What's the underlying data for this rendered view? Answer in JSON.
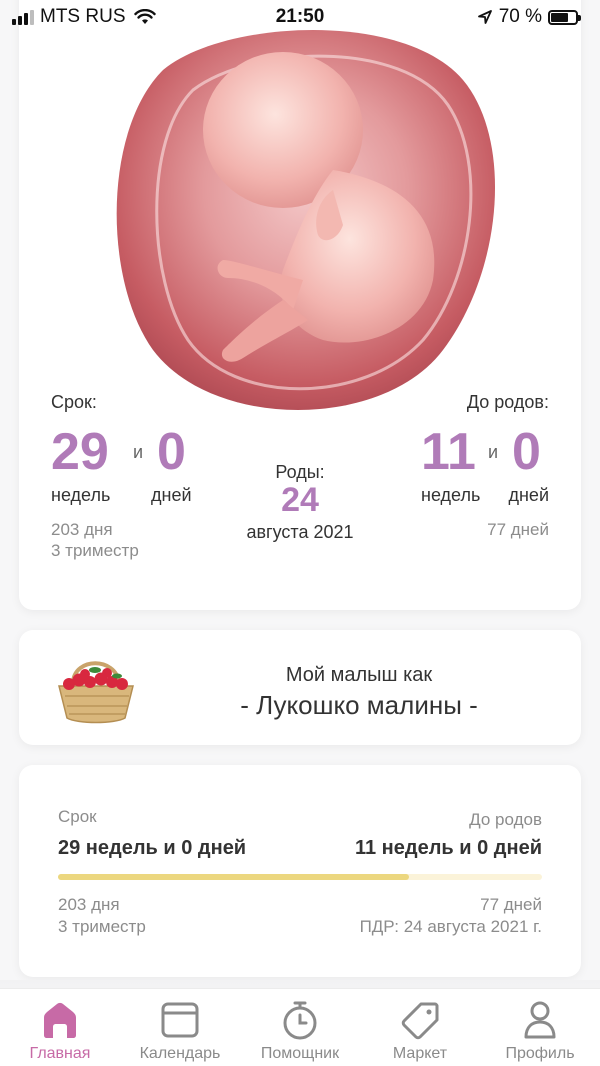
{
  "status_bar": {
    "carrier": "MTS RUS",
    "time": "21:50",
    "battery": "70 %",
    "battery_level": 0.7
  },
  "summary": {
    "term_label": "Срок:",
    "term_weeks": "29",
    "and": "и",
    "term_days": "0",
    "weeks_label": "недель",
    "days_label": "дней",
    "term_total_days": "203 дня",
    "trimester": "3 триместр",
    "birth_label": "Роды:",
    "birth_day": "24",
    "birth_month_year": "августа 2021",
    "until_label": "До родов:",
    "until_weeks": "11",
    "until_days": "0",
    "until_total_days": "77 дней"
  },
  "fruit": {
    "intro": "Мой малыш как",
    "name": "- Лукошко малины -"
  },
  "progress": {
    "term_label": "Срок",
    "term_value": "29 недель и 0 дней",
    "until_label": "До родов",
    "until_value": "11 недель и 0 дней",
    "fraction": 0.725,
    "left_days": "203 дня",
    "left_trimester": "3 триместр",
    "right_days": "77 дней",
    "due_date": "ПДР: 24 августа 2021 г."
  },
  "tabs": [
    {
      "label": "Главная",
      "icon": "home-icon",
      "active": true
    },
    {
      "label": "Календарь",
      "icon": "calendar-icon",
      "active": false
    },
    {
      "label": "Помощник",
      "icon": "stopwatch-icon",
      "active": false
    },
    {
      "label": "Маркет",
      "icon": "tag-icon",
      "active": false
    },
    {
      "label": "Профиль",
      "icon": "person-icon",
      "active": false
    }
  ],
  "colors": {
    "accent": "#b07bb8",
    "tab_active": "#c76aa6",
    "progress_fill": "#ecd77f"
  }
}
